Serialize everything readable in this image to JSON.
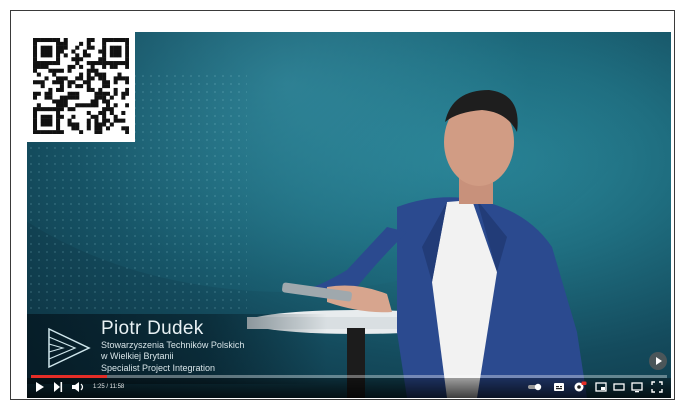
{
  "video": {
    "lower_third": {
      "name": "Piotr Dudek",
      "line1": "Stowarzyszenia Techników Polskich",
      "line2": "w Wielkiej Brytanii",
      "line3": "Specialist Project Integration"
    },
    "player": {
      "time": "1:25 / 11:58",
      "progress": 0.12
    },
    "icons": {
      "play": "play-icon",
      "next": "next-icon",
      "volume": "volume-icon",
      "autoplay": "autoplay-toggle-icon",
      "subtitles": "subtitles-icon",
      "settings": "settings-icon",
      "miniplayer": "miniplayer-icon",
      "theater": "theater-icon",
      "cast": "cast-icon",
      "fullscreen": "fullscreen-icon"
    },
    "colors": {
      "progress": "#e52d27",
      "background": "#0f3c4e"
    }
  }
}
